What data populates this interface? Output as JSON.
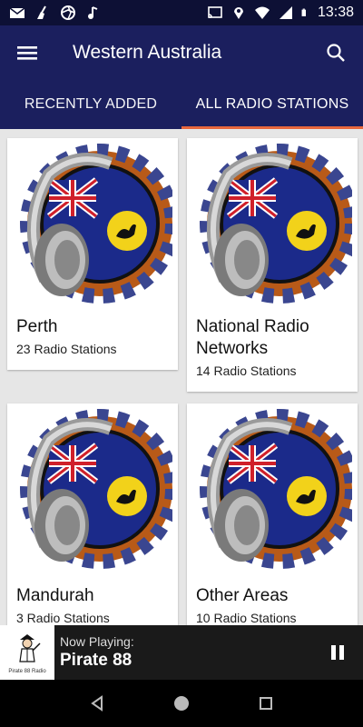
{
  "status_bar": {
    "time": "13:38",
    "left_icons": [
      "email-icon",
      "broom-icon",
      "aperture-icon",
      "music-note-icon"
    ],
    "right_icons": [
      "cast-icon",
      "location-icon",
      "wifi-icon",
      "signal-icon",
      "battery-icon"
    ]
  },
  "app_bar": {
    "title": "Western Australia",
    "menu_icon": "hamburger-menu-icon",
    "search_icon": "search-icon"
  },
  "tabs": [
    {
      "label": "RECENTLY ADDED",
      "active": false
    },
    {
      "label": "ALL RADIO STATIONS",
      "active": true
    }
  ],
  "cards": [
    {
      "name": "Perth",
      "count": "23 Radio Stations"
    },
    {
      "name": "National Radio Networks",
      "count": "14 Radio Stations"
    },
    {
      "name": "Mandurah",
      "count": "3 Radio Stations"
    },
    {
      "name": "Other Areas",
      "count": "10 Radio Stations"
    }
  ],
  "now_playing": {
    "label": "Now Playing:",
    "station": "Pirate 88",
    "thumb_caption": "Pirate 88 Radio"
  },
  "nav_bar": {
    "icons": [
      "back-icon",
      "home-icon",
      "recents-icon"
    ]
  },
  "colors": {
    "status_bar": "#0d1035",
    "app_bar": "#1b1f5e",
    "tab_indicator": "#e8673c",
    "player_bar": "#1a1a1a",
    "nav_bar": "#000000"
  }
}
